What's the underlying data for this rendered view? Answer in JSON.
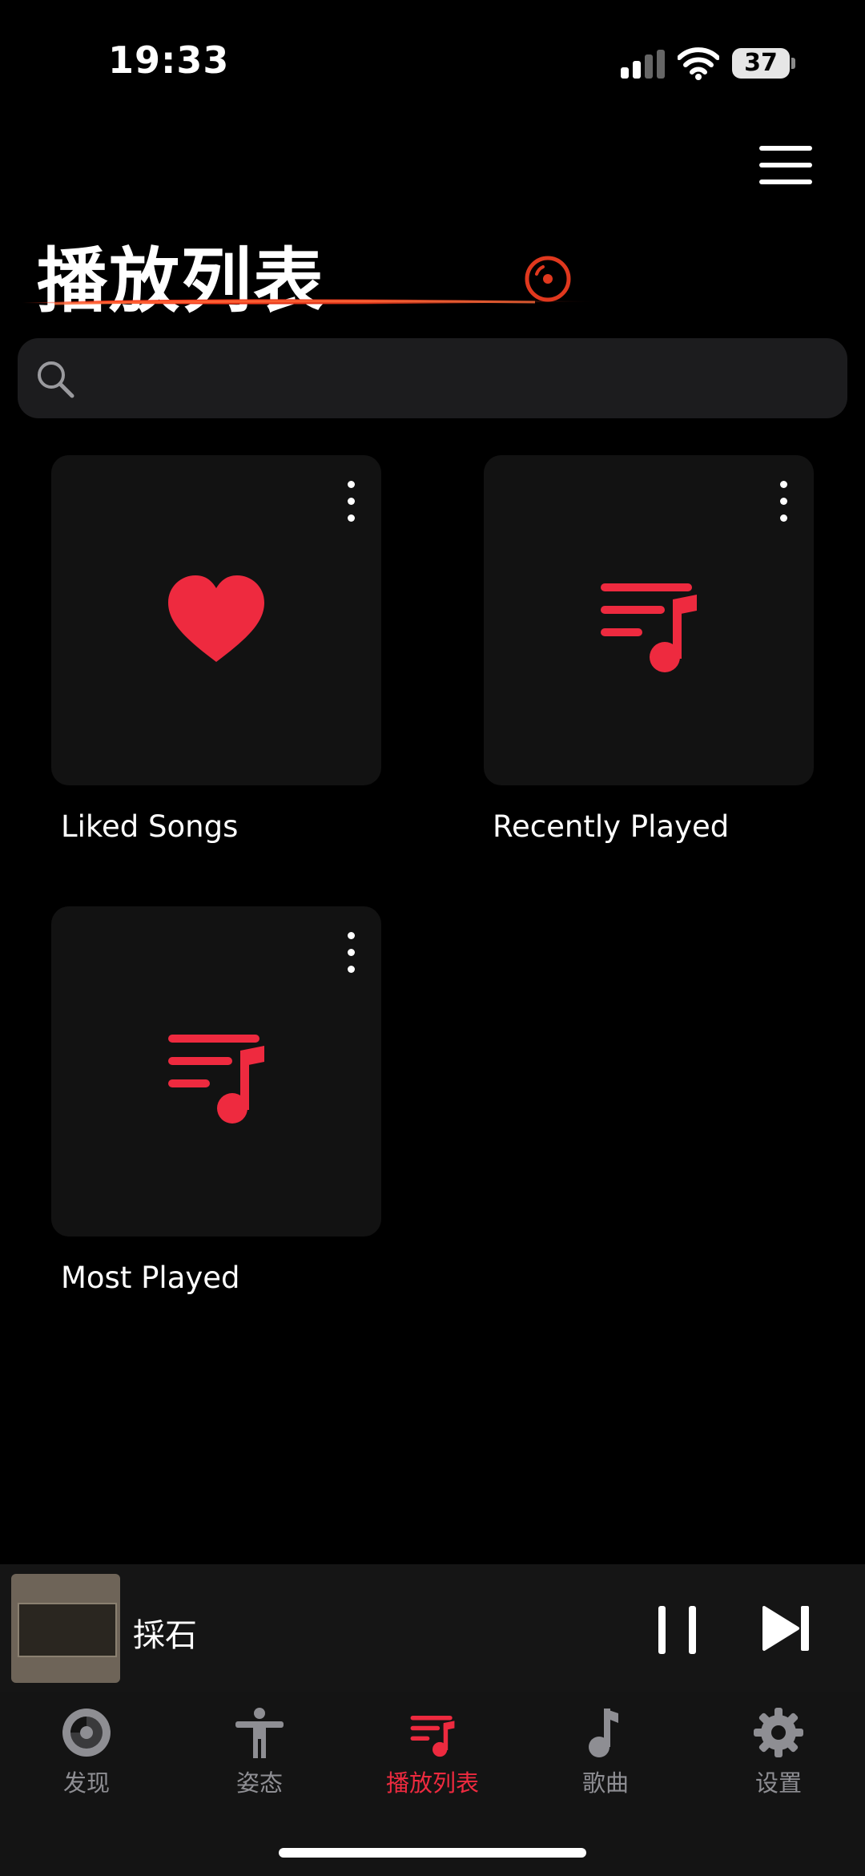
{
  "status_bar": {
    "time": "19:33",
    "battery": "37"
  },
  "header": {
    "title": "播放列表"
  },
  "search": {
    "placeholder": ""
  },
  "playlists": [
    {
      "name": "Liked Songs",
      "icon": "heart-icon"
    },
    {
      "name": "Recently Played",
      "icon": "playlist-icon"
    },
    {
      "name": "Most Played",
      "icon": "playlist-icon"
    }
  ],
  "now_playing": {
    "title": "採石"
  },
  "tabs": [
    {
      "label": "发现",
      "icon": "disc-icon",
      "active": false
    },
    {
      "label": "姿态",
      "icon": "person-icon",
      "active": false
    },
    {
      "label": "播放列表",
      "icon": "playlist-icon",
      "active": true
    },
    {
      "label": "歌曲",
      "icon": "music-note-icon",
      "active": false
    },
    {
      "label": "设置",
      "icon": "gear-icon",
      "active": false
    }
  ],
  "colors": {
    "accent": "#ee2a3f",
    "background": "#000000",
    "card": "#121212",
    "search": "#1c1c1e",
    "inactive_tab": "#8e8e93"
  }
}
